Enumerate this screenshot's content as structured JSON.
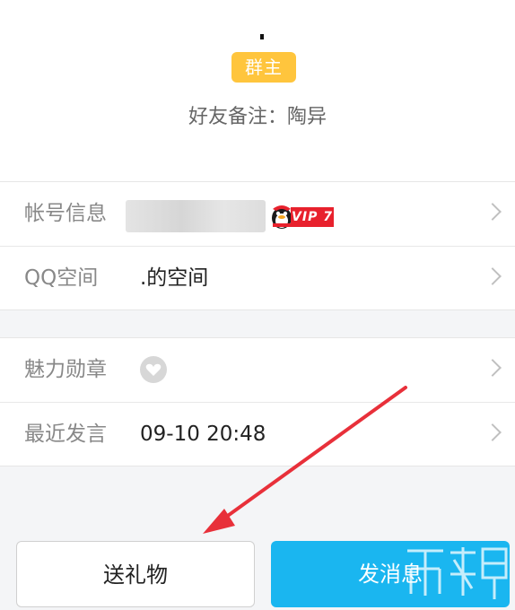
{
  "header": {
    "role_badge": "群主",
    "remark": "好友备注：陶异"
  },
  "info_rows": [
    {
      "label": "帐号信息",
      "value": "",
      "vip_badge": "VIP 7"
    },
    {
      "label": "QQ空间",
      "value": ".的空间"
    }
  ],
  "activity_rows": [
    {
      "label": "魅力勋章",
      "value": ""
    },
    {
      "label": "最近发言",
      "value": "09-10 20:48"
    }
  ],
  "buttons": {
    "gift": "送礼物",
    "message": "发消息"
  },
  "colors": {
    "badge": "#ffc53d",
    "primary": "#1ab6f0",
    "annotation_arrow": "#e8303a",
    "vip": "#e8212d"
  },
  "icons": [
    "qq-penguin-icon",
    "heart-medal-icon",
    "chevron-right-icon"
  ]
}
